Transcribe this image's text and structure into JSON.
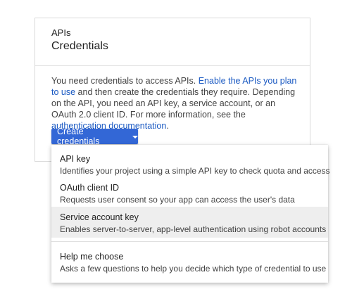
{
  "card": {
    "kicker": "APIs",
    "title": "Credentials",
    "body": {
      "text1": "You need credentials to access APIs. ",
      "link1": "Enable the APIs you plan to use",
      "text2": " and then create the credentials they require. Depending on the API, you need an API key, a service account, or an OAuth 2.0 client ID. For more information, see the ",
      "link2": "authentication documentation",
      "text3": "."
    },
    "create_button_label": "Create credentials"
  },
  "menu": {
    "items": [
      {
        "title": "API key",
        "description": "Identifies your project using a simple API key to check quota and access"
      },
      {
        "title": "OAuth client ID",
        "description": "Requests user consent so your app can access the user's data"
      },
      {
        "title": "Service account key",
        "description": "Enables server-to-server, app-level authentication using robot accounts"
      },
      {
        "title": "Help me choose",
        "description": "Asks a few questions to help you decide which type of credential to use"
      }
    ]
  },
  "colors": {
    "accent": "#3367d6",
    "link": "#1a59c2",
    "highlight": "#eeeeee"
  },
  "icons": {
    "dropdown": "caret-down-icon"
  }
}
